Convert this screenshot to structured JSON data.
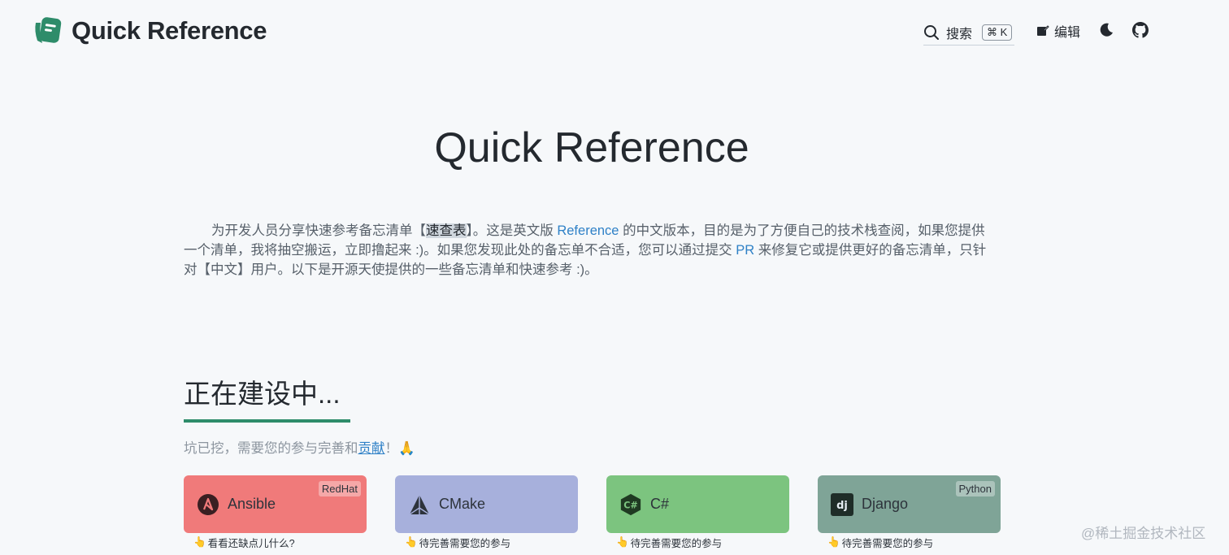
{
  "header": {
    "logo_text": "Quick Reference",
    "search_label": "搜索",
    "search_shortcut": "⌘ K",
    "edit_label": "编辑"
  },
  "hero": {
    "title": "Quick Reference",
    "intro_part1": "为开发人员分享快速参考备忘清单【",
    "intro_highlight": "速查表",
    "intro_part2": "】。这是英文版 ",
    "intro_link1": "Reference",
    "intro_part3": " 的中文版本，目的是为了方便自己的技术栈查阅，如果您提供一个清单，我将抽空搬运，立即撸起来 :)。如果您发现此处的备忘单不合适，您可以通过提交 ",
    "intro_link2": "PR",
    "intro_part4": " 来修复它或提供更好的备忘清单，只针对【中文】用户。以下是开源天使提供的一些备忘清单和快速参考 :)。"
  },
  "building": {
    "title": "正在建设中...",
    "sub_prefix": "坑已挖，需要您的参与完善和",
    "sub_link": "贡献",
    "sub_suffix": "！🙏"
  },
  "cards": [
    {
      "label": "Ansible",
      "tag": "RedHat",
      "note": "看看还缺点儿什么?",
      "color": "#f07a7a"
    },
    {
      "label": "CMake",
      "tag": "",
      "note": "待完善需要您的参与",
      "color": "#a7b0dc"
    },
    {
      "label": "C#",
      "tag": "",
      "note": "待完善需要您的参与",
      "color": "#7cc47f"
    },
    {
      "label": "Django",
      "tag": "Python",
      "note": "待完善需要您的参与",
      "color": "#7fa497"
    }
  ],
  "watermark": "@稀土掘金技术社区"
}
